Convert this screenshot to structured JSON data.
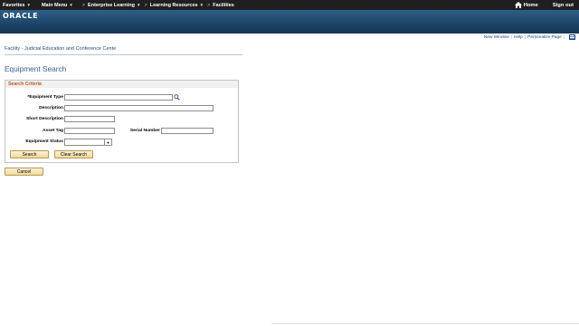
{
  "topnav": {
    "favorites": "Favorites",
    "main_menu": "Main Menu",
    "enterprise_learning": "Enterprise Learning",
    "learning_resources": "Learning Resources",
    "facilities": "Facilities",
    "home": "Home",
    "sign_out": "Sign out",
    "sep": ">"
  },
  "logo": "ORACLE",
  "pagebar": {
    "new_window": "New Window",
    "help": "Help",
    "personalize_page": "Personalize Page",
    "sep": "|"
  },
  "breadcrumb": "Facility - Judicial Education and Conference Cente",
  "page_title": "Equipment Search",
  "search_criteria": {
    "title": "Search Criteria",
    "equipment_type_label": "*Equipment Type",
    "equipment_type_value": "",
    "description_label": "Description",
    "description_value": "",
    "short_description_label": "Short Description",
    "short_description_value": "",
    "asset_tag_label": "Asset Tag",
    "asset_tag_value": "",
    "serial_number_label": "Serial Number",
    "serial_number_value": "",
    "equipment_status_label": "Equipment Status",
    "equipment_status_value": ""
  },
  "buttons": {
    "search": "Search",
    "clear_search": "Clear Search",
    "cancel": "Cancel"
  },
  "icons": {
    "home": "home-icon",
    "lookup": "magnifier-icon",
    "grid": "grid-icon"
  },
  "colors": {
    "topnav_bg": "#1f1f1f",
    "banner": "#1d4467",
    "link": "#1a3f7a",
    "section_title": "#c15a1e",
    "button_bg": "#f5d79a"
  }
}
